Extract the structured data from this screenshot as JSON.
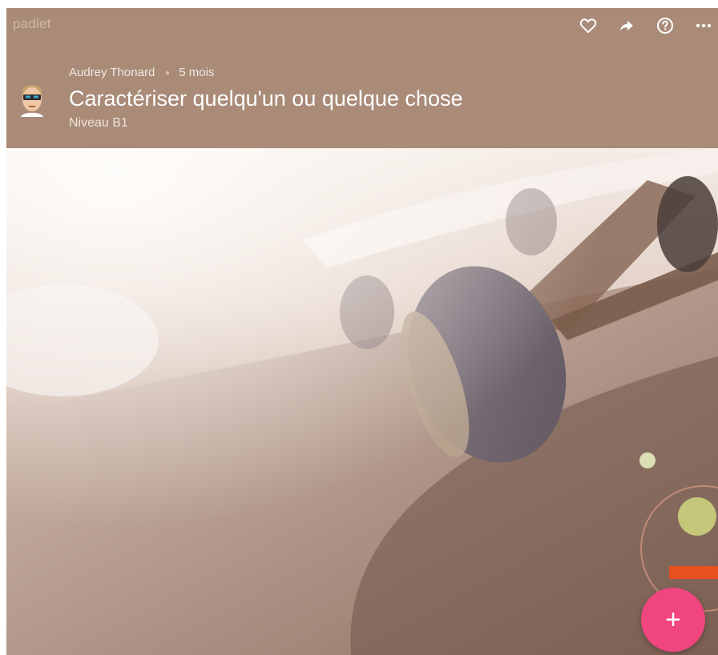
{
  "app": {
    "brand": "padlet"
  },
  "toolbar": {
    "items": [
      {
        "icon": "heart-icon"
      },
      {
        "icon": "share-arrow-icon"
      },
      {
        "icon": "help-icon"
      },
      {
        "icon": "more-icon"
      }
    ]
  },
  "post": {
    "author": "Audrey Thonard",
    "time_ago": "5 mois",
    "title": "Caractériser quelqu'un ou quelque chose",
    "subtitle": "Niveau B1"
  },
  "colors": {
    "header_bg": "#a98b78",
    "fab_bg": "#f0457f",
    "accent_orange": "#e8501e"
  },
  "fab": {
    "label": "+"
  }
}
